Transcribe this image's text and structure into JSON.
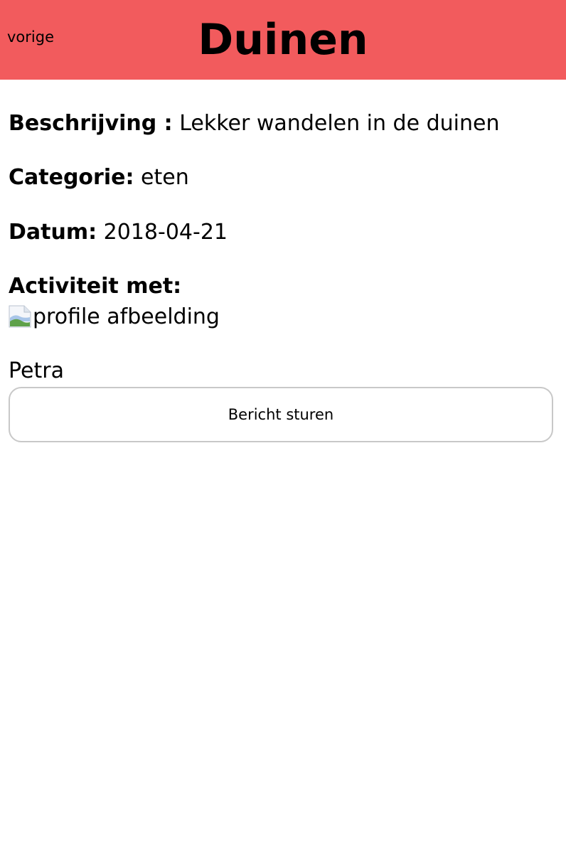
{
  "header": {
    "back_label": "vorige",
    "title": "Duinen",
    "background_color": "#f25b5d"
  },
  "details": {
    "description_label": "Beschrijving :",
    "description_value": "Lekker wandelen in de duinen",
    "category_label": "Categorie:",
    "category_value": "eten",
    "date_label": "Datum:",
    "date_value": "2018-04-21",
    "activity_with_label": "Activiteit met:",
    "profile_image_alt": "profile afbeelding",
    "profile_image_icon": "broken-image-icon",
    "person_name": "Petra"
  },
  "actions": {
    "send_message_label": "Bericht sturen"
  }
}
